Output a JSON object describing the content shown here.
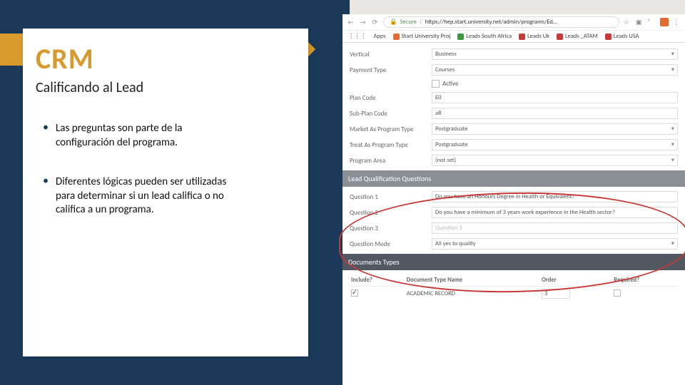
{
  "slide": {
    "title": "CRM",
    "subtitle": "Calificando al Lead",
    "bullets": [
      "Las preguntas son parte de la configuración del programa.",
      "Diferentes lógicas pueden ser utilizadas para determinar si un lead califica o no califica a un programa."
    ]
  },
  "browser": {
    "secure_label": "Secure",
    "url": "https://hep.start.university.net/admin/programs/Ed…",
    "bookmarks": [
      "Apps",
      "Start University Proj",
      "Leads South Africa",
      "Leads Uk",
      "Leads _ATAM",
      "Leads USA"
    ]
  },
  "form": {
    "vertical": {
      "label": "Vertical",
      "value": "Business"
    },
    "payment_type": {
      "label": "Payment Type",
      "value": "Courses"
    },
    "active": {
      "label": "Active"
    },
    "plan_code": {
      "label": "Plan Code",
      "value": "E0"
    },
    "sub_plan_code": {
      "label": "Sub-Plan Code",
      "value": "aR"
    },
    "market_as": {
      "label": "Market As Program Type",
      "value": "Postgraduate"
    },
    "treat_as": {
      "label": "Treat As Program Type",
      "value": "Postgraduate"
    },
    "program_area": {
      "label": "Program Area",
      "value": "(not set)"
    }
  },
  "lead_qual": {
    "header": "Lead Qualification Questions",
    "q1": {
      "label": "Question 1",
      "value": "Do you have an Honours Degree in Health or Equivalent?"
    },
    "q2": {
      "label": "Question 2",
      "value": "Do you have a minimum of 3 years work experience in the Health sector?"
    },
    "q3": {
      "label": "Question 3",
      "value": "Question 3"
    },
    "mode": {
      "label": "Question Mode",
      "value": "All yes to qualify"
    }
  },
  "docs": {
    "header": "Documents Types",
    "cols": {
      "include": "Include?",
      "name": "Document Type Name",
      "order": "Order",
      "required": "Required?"
    },
    "row": {
      "name": "ACADEMIC RECORD",
      "order": "3"
    }
  }
}
